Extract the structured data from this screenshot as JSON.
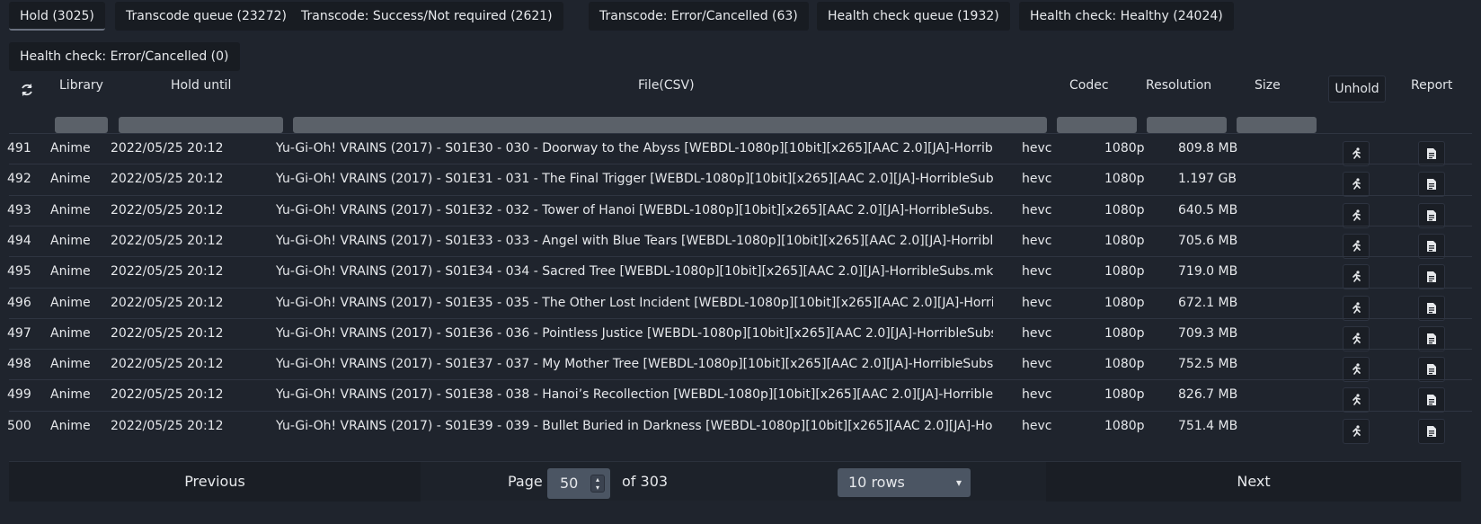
{
  "tabs": [
    {
      "label": "Hold (3025)"
    },
    {
      "label": "Transcode queue (23272)"
    },
    {
      "label": "Transcode: Success/Not required (2621)"
    },
    {
      "label": "Transcode: Error/Cancelled (63)"
    },
    {
      "label": "Health check queue (1932)"
    },
    {
      "label": "Health check: Healthy (24024)"
    },
    {
      "label": "Health check: Error/Cancelled (0)"
    }
  ],
  "table": {
    "headers": {
      "library": "Library",
      "hold_until": "Hold until",
      "file": "File(CSV)",
      "codec": "Codec",
      "resolution": "Resolution",
      "size": "Size",
      "unhold": "Unhold",
      "report": "Report"
    },
    "rows": [
      {
        "num": "491",
        "library": "Anime",
        "hold_until": "2022/05/25 20:12",
        "file": "Yu-Gi-Oh! VRAINS (2017) - S01E30 - 030 - Doorway to the Abyss [WEBDL-1080p][10bit][x265][AAC 2.0][JA]-HorribleSubs.mkv",
        "codec": "hevc",
        "resolution": "1080p",
        "size": "809.8 MB"
      },
      {
        "num": "492",
        "library": "Anime",
        "hold_until": "2022/05/25 20:12",
        "file": "Yu-Gi-Oh! VRAINS (2017) - S01E31 - 031 - The Final Trigger [WEBDL-1080p][10bit][x265][AAC 2.0][JA]-HorribleSubs.mkv",
        "codec": "hevc",
        "resolution": "1080p",
        "size": "1.197 GB"
      },
      {
        "num": "493",
        "library": "Anime",
        "hold_until": "2022/05/25 20:12",
        "file": "Yu-Gi-Oh! VRAINS (2017) - S01E32 - 032 - Tower of Hanoi [WEBDL-1080p][10bit][x265][AAC 2.0][JA]-HorribleSubs.mkv",
        "codec": "hevc",
        "resolution": "1080p",
        "size": "640.5 MB"
      },
      {
        "num": "494",
        "library": "Anime",
        "hold_until": "2022/05/25 20:12",
        "file": "Yu-Gi-Oh! VRAINS (2017) - S01E33 - 033 - Angel with Blue Tears [WEBDL-1080p][10bit][x265][AAC 2.0][JA]-HorribleSubs.mkv",
        "codec": "hevc",
        "resolution": "1080p",
        "size": "705.6 MB"
      },
      {
        "num": "495",
        "library": "Anime",
        "hold_until": "2022/05/25 20:12",
        "file": "Yu-Gi-Oh! VRAINS (2017) - S01E34 - 034 - Sacred Tree [WEBDL-1080p][10bit][x265][AAC 2.0][JA]-HorribleSubs.mkv",
        "codec": "hevc",
        "resolution": "1080p",
        "size": "719.0 MB"
      },
      {
        "num": "496",
        "library": "Anime",
        "hold_until": "2022/05/25 20:12",
        "file": "Yu-Gi-Oh! VRAINS (2017) - S01E35 - 035 - The Other Lost Incident [WEBDL-1080p][10bit][x265][AAC 2.0][JA]-HorribleSubs.mkv",
        "codec": "hevc",
        "resolution": "1080p",
        "size": "672.1 MB"
      },
      {
        "num": "497",
        "library": "Anime",
        "hold_until": "2022/05/25 20:12",
        "file": "Yu-Gi-Oh! VRAINS (2017) - S01E36 - 036 - Pointless Justice [WEBDL-1080p][10bit][x265][AAC 2.0][JA]-HorribleSubs.mkv",
        "codec": "hevc",
        "resolution": "1080p",
        "size": "709.3 MB"
      },
      {
        "num": "498",
        "library": "Anime",
        "hold_until": "2022/05/25 20:12",
        "file": "Yu-Gi-Oh! VRAINS (2017) - S01E37 - 037 - My Mother Tree [WEBDL-1080p][10bit][x265][AAC 2.0][JA]-HorribleSubs.mkv",
        "codec": "hevc",
        "resolution": "1080p",
        "size": "752.5 MB"
      },
      {
        "num": "499",
        "library": "Anime",
        "hold_until": "2022/05/25 20:12",
        "file": "Yu-Gi-Oh! VRAINS (2017) - S01E38 - 038 - Hanoi’s Recollection [WEBDL-1080p][10bit][x265][AAC 2.0][JA]-HorribleSubs.mkv",
        "codec": "hevc",
        "resolution": "1080p",
        "size": "826.7 MB"
      },
      {
        "num": "500",
        "library": "Anime",
        "hold_until": "2022/05/25 20:12",
        "file": "Yu-Gi-Oh! VRAINS (2017) - S01E39 - 039 - Bullet Buried in Darkness [WEBDL-1080p][10bit][x265][AAC 2.0][JA]-HorribleSubs.mkv",
        "codec": "hevc",
        "resolution": "1080p",
        "size": "751.4 MB"
      }
    ]
  },
  "pagination": {
    "previous_label": "Previous",
    "page_label": "Page",
    "page_value": "50",
    "of_label": "of 303",
    "rows_option": "10 rows",
    "next_label": "Next"
  },
  "icons": {
    "refresh": "refresh-icon",
    "unhold": "running-person-icon",
    "report": "document-icon",
    "stepper": "stepper-icon",
    "select": "chevron-down-icon"
  }
}
